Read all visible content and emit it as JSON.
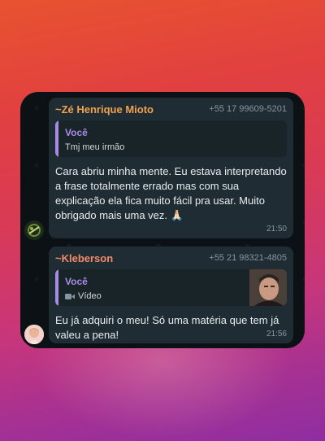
{
  "messages": [
    {
      "sender": "~Zé Henrique Mioto",
      "sender_color": "#f2a14d",
      "phone": "+55 17 99609-5201",
      "quote": {
        "author": "Você",
        "text": "Tmj meu irmão"
      },
      "text": "Cara abriu minha mente. Eu estava interpretando a frase totalmente errado mas com sua explicação ela fica muito fácil pra usar. Muito obrigado mais uma vez. 🙏🏻",
      "time": "21:50"
    },
    {
      "sender": "~Kleberson",
      "sender_color": "#f08a6a",
      "phone": "+55 21 98321-4805",
      "quote": {
        "author": "Você",
        "text": "Vídeo",
        "icon": "video-camera-icon"
      },
      "text": "Eu já adquiri o meu! Só uma matéria que tem já valeu a pena!",
      "time": "21:56"
    }
  ]
}
